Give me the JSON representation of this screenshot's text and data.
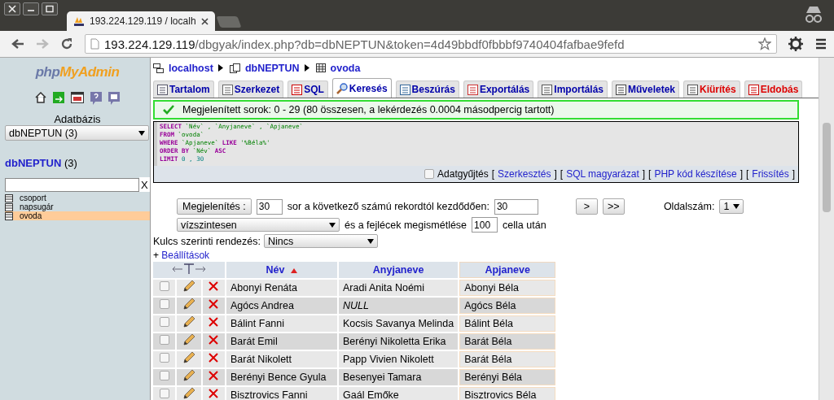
{
  "browser": {
    "tab_title": "193.224.129.119 / localh",
    "url_host": "193.224.129.119",
    "url_path": "/dbgyak/index.php?db=dbNEPTUN&token=4d49bbdf0fbbbf9740404fafbae9fefd"
  },
  "sidebar": {
    "logo": "phpMyAdmin",
    "db_label": "Adatbázis",
    "db_select": "dbNEPTUN (3)",
    "db_name": "dbNEPTUN",
    "db_count": "(3)",
    "filter_clear": "X",
    "tables": [
      {
        "name": "csoport",
        "selected": false
      },
      {
        "name": "napsugár",
        "selected": false
      },
      {
        "name": "ovoda",
        "selected": true
      }
    ]
  },
  "breadcrumb": [
    {
      "kind": "server",
      "label": "localhost"
    },
    {
      "kind": "database",
      "label": "dbNEPTUN"
    },
    {
      "kind": "table",
      "label": "ovoda"
    }
  ],
  "tabs": [
    {
      "label": "Tartalom",
      "kind": "browse",
      "selected": false
    },
    {
      "label": "Szerkezet",
      "kind": "structure",
      "selected": false
    },
    {
      "label": "SQL",
      "kind": "sql",
      "selected": false
    },
    {
      "label": "Keresés",
      "kind": "search",
      "selected": true
    },
    {
      "label": "Beszúrás",
      "kind": "insert",
      "selected": false
    },
    {
      "label": "Exportálás",
      "kind": "export",
      "selected": false
    },
    {
      "label": "Importálás",
      "kind": "import",
      "selected": false
    },
    {
      "label": "Műveletek",
      "kind": "operations",
      "selected": false
    },
    {
      "label": "Kiürítés",
      "kind": "empty",
      "selected": false
    },
    {
      "label": "Eldobás",
      "kind": "drop",
      "selected": false
    }
  ],
  "success_message": "Megjelenített sorok: 0 - 29 (80 összesen, a lekérdezés 0.0004 másodpercig tartott)",
  "sql_lines": [
    [
      {
        "t": "SELECT",
        "kind": "keyword"
      },
      {
        "t": " `Név` , `Anyjaneve` , `Apjaneve`",
        "kind": "ident"
      }
    ],
    [
      {
        "t": "FROM",
        "kind": "keyword"
      },
      {
        "t": " `ovoda`",
        "kind": "ident"
      }
    ],
    [
      {
        "t": "WHERE",
        "kind": "keyword"
      },
      {
        "t": " `Apjaneve` ",
        "kind": "ident"
      },
      {
        "t": "LIKE",
        "kind": "keyword"
      },
      {
        "t": " '%Béla%'",
        "kind": "string"
      }
    ],
    [
      {
        "t": "ORDER BY",
        "kind": "keyword"
      },
      {
        "t": " `Név` ",
        "kind": "ident"
      },
      {
        "t": "ASC",
        "kind": "keyword"
      }
    ],
    [
      {
        "t": "LIMIT",
        "kind": "keyword"
      },
      {
        "t": " 0 , 30",
        "kind": "number"
      }
    ]
  ],
  "sql_actions": {
    "profiling_label": "Adatgyűjtés",
    "profiling_checked": false,
    "bracket_open": "[",
    "bracket_close": "]",
    "links": [
      "Szerkesztés",
      "SQL magyarázat",
      "PHP kód készítése",
      "Frissítés"
    ]
  },
  "navigation": {
    "show_button": "Megjelenítés :",
    "rows_value": "30",
    "rows_text": "sor a következő számú rekordtól kezdődően:",
    "start_value": "30",
    "next": ">",
    "last": ">>",
    "page_label": "Oldalszám:",
    "page_value": "1",
    "mode_value": "vízszintesen",
    "repeat_text": "és a fejlécek megismétlése",
    "repeat_value": "100",
    "repeat_suffix": "cella után",
    "sort_label": "Kulcs szerinti rendezés:",
    "sort_value": "Nincs",
    "options_plus": "+",
    "options_link": "Beállítások"
  },
  "table": {
    "columns": [
      {
        "label": "Név",
        "sorted_ascending": true
      },
      {
        "label": "Anyjaneve",
        "sorted_ascending": false
      },
      {
        "label": "Apjaneve",
        "sorted_ascending": false
      }
    ],
    "rows": [
      {
        "checked": false,
        "nev": "Abonyi Renáta",
        "anyjaneve": "Aradi Anita Noémi",
        "anyjaneve_null": false,
        "apjaneve": "Abonyi Béla"
      },
      {
        "checked": false,
        "nev": "Agócs Andrea",
        "anyjaneve": "NULL",
        "anyjaneve_null": true,
        "apjaneve": "Agócs Béla"
      },
      {
        "checked": false,
        "nev": "Bálint Fanni",
        "anyjaneve": "Kocsis Savanya Melinda",
        "anyjaneve_null": false,
        "apjaneve": "Bálint Béla"
      },
      {
        "checked": false,
        "nev": "Barát Emil",
        "anyjaneve": "Berényi Nikoletta Erika",
        "anyjaneve_null": false,
        "apjaneve": "Barát Béla"
      },
      {
        "checked": false,
        "nev": "Barát Nikolett",
        "anyjaneve": "Papp Vivien Nikolett",
        "anyjaneve_null": false,
        "apjaneve": "Barát Béla"
      },
      {
        "checked": false,
        "nev": "Berényi Bence Gyula",
        "anyjaneve": "Besenyei Tamara",
        "anyjaneve_null": false,
        "apjaneve": "Berényi Béla"
      },
      {
        "checked": false,
        "nev": "Bisztrovics Fanni",
        "anyjaneve": "Gaál Emőke",
        "anyjaneve_null": false,
        "apjaneve": "Bisztrovics Béla"
      }
    ]
  }
}
